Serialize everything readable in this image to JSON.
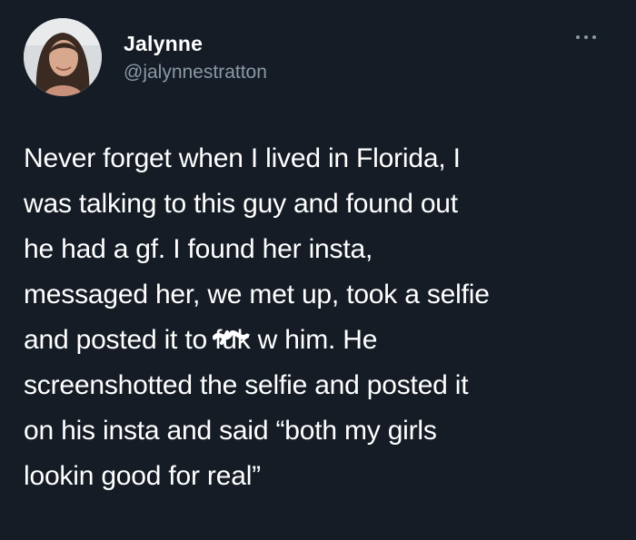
{
  "user": {
    "display_name": "Jalynne",
    "handle": "@jalynnestratton",
    "avatar_icon": "profile-photo"
  },
  "more_icon": "more-options-icon",
  "tweet": {
    "lines": [
      "Never forget when I lived in Florida, I",
      "was talking to this guy and found out",
      "he had a gf. I found her insta,",
      "messaged her, we met up, took a selfie"
    ],
    "line5_before": "and posted it to ",
    "line5_censored": "fu",
    "line5_after": "k w him. He",
    "lines_end": [
      "screenshotted the selfie and posted it",
      "on his insta and said “both my girls",
      "lookin good for real”"
    ]
  },
  "colors": {
    "background": "#151c26",
    "text": "#ffffff",
    "secondary": "#8899a6"
  }
}
